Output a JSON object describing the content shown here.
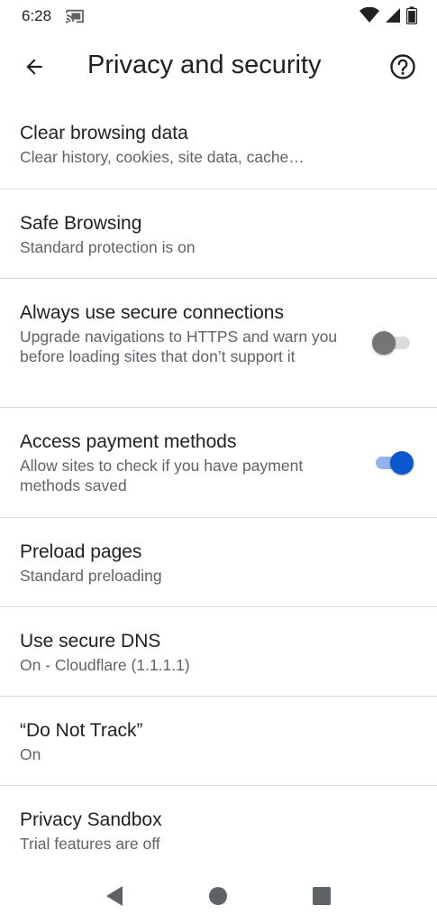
{
  "status_bar": {
    "time": "6:28",
    "icons": [
      "cast-icon",
      "wifi-icon",
      "signal-icon",
      "battery-icon"
    ]
  },
  "app_bar": {
    "title": "Privacy and security",
    "back_icon": "arrow-back-icon",
    "help_icon": "help-circle-icon"
  },
  "settings": [
    {
      "title": "Clear browsing data",
      "summary": "Clear history, cookies, site data, cache…"
    },
    {
      "title": "Safe Browsing",
      "summary": "Standard protection is on"
    },
    {
      "title": "Always use secure connections",
      "summary": "Upgrade navigations to HTTPS and warn you before loading sites that don’t support it",
      "toggle": "off"
    },
    {
      "title": "Access payment methods",
      "summary": "Allow sites to check if you have payment methods saved",
      "toggle": "on"
    },
    {
      "title": "Preload pages",
      "summary": "Standard preloading"
    },
    {
      "title": "Use secure DNS",
      "summary": "On - Cloudflare (1.1.1.1)"
    },
    {
      "title": "“Do Not Track”",
      "summary": "On"
    },
    {
      "title": "Privacy Sandbox",
      "summary": "Trial features are off"
    }
  ],
  "colors": {
    "accent": "#0b57d0",
    "toggle_on_track": "#93b4ea",
    "toggle_off_thumb": "#757575",
    "divider": "#dadce0",
    "text_primary": "#202124",
    "text_secondary": "#5f6368"
  },
  "nav_bar": {
    "icons": [
      "nav-back-icon",
      "nav-home-icon",
      "nav-recents-icon"
    ]
  }
}
